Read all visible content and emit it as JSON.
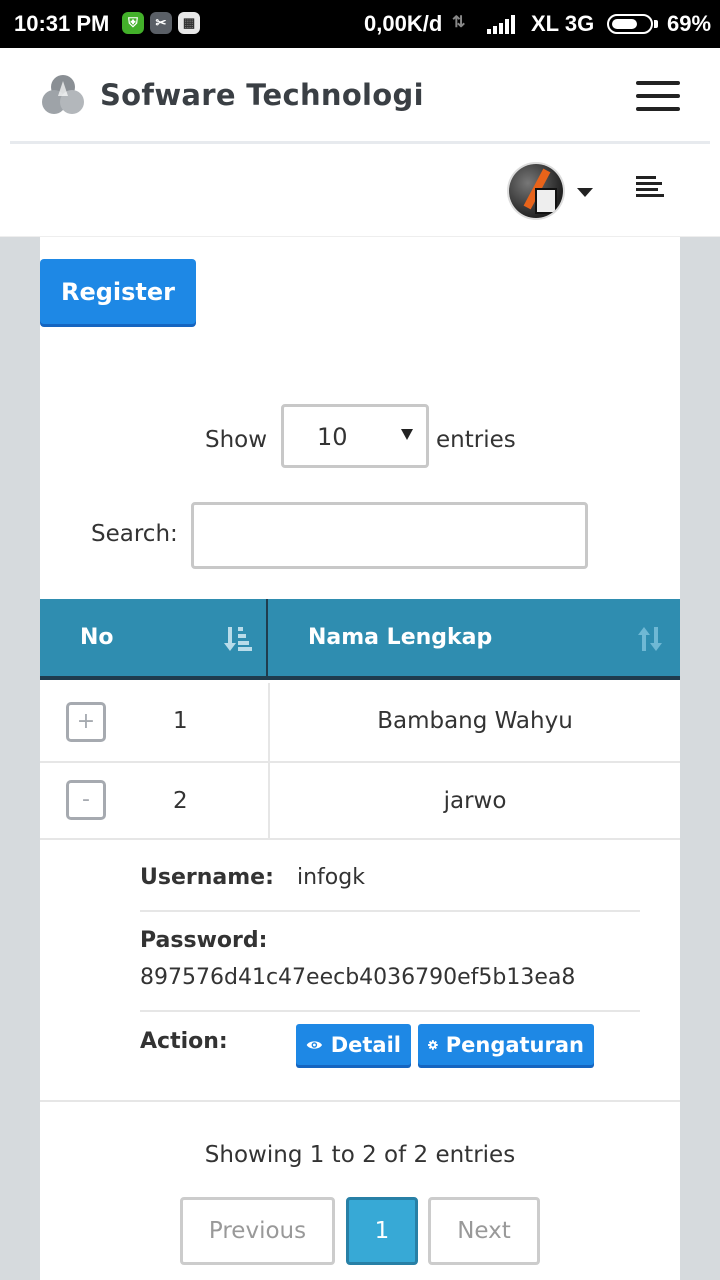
{
  "status_bar": {
    "time": "10:31 PM",
    "network_speed": "0,00K/d",
    "carrier": "XL 3G",
    "battery_percent": "69%",
    "battery_level": 0.69
  },
  "navbar": {
    "brand": "Sofware Technologi"
  },
  "main": {
    "register_label": "Register",
    "length": {
      "show_label": "Show",
      "selected": "10",
      "entries_label": "entries"
    },
    "search": {
      "label": "Search:",
      "value": ""
    },
    "table": {
      "columns": [
        "No",
        "Nama Lengkap"
      ],
      "rows": [
        {
          "toggle": "+",
          "no": "1",
          "name": "Bambang Wahyu"
        },
        {
          "toggle": "-",
          "no": "2",
          "name": "jarwo"
        }
      ],
      "details": {
        "username_label": "Username:",
        "username_value": "infogk",
        "password_label": "Password:",
        "password_value": "897576d41c47eecb4036790ef5b13ea8",
        "action_label": "Action:",
        "detail_button": "Detail",
        "settings_button": "Pengaturan"
      }
    },
    "info": "Showing 1 to 2 of 2 entries",
    "pagination": {
      "previous": "Previous",
      "current": "1",
      "next": "Next"
    }
  },
  "colors": {
    "primary": "#1e88e5",
    "table_header": "#2f8db0",
    "active_page": "#37a9d6"
  }
}
